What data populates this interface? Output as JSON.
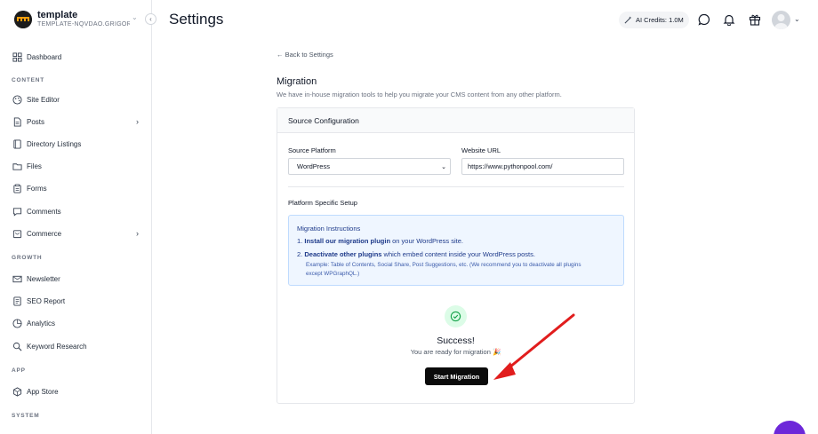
{
  "sidebar": {
    "brand": {
      "name": "template",
      "subtitle": "TEMPLATE-NQVDAO.GRIGOR..."
    },
    "items": [
      {
        "label": "Dashboard",
        "icon": "dashboard-icon"
      },
      {
        "label": "Site Editor",
        "icon": "palette-icon"
      },
      {
        "label": "Posts",
        "icon": "document-icon"
      },
      {
        "label": "Directory Listings",
        "icon": "book-icon"
      },
      {
        "label": "Files",
        "icon": "folder-icon"
      },
      {
        "label": "Forms",
        "icon": "clipboard-icon"
      },
      {
        "label": "Comments",
        "icon": "comment-icon"
      },
      {
        "label": "Commerce",
        "icon": "cart-icon"
      },
      {
        "label": "Newsletter",
        "icon": "mail-icon"
      },
      {
        "label": "SEO Report",
        "icon": "report-icon"
      },
      {
        "label": "Analytics",
        "icon": "analytics-icon"
      },
      {
        "label": "Keyword Research",
        "icon": "search-icon"
      },
      {
        "label": "App Store",
        "icon": "box-icon"
      }
    ],
    "sections": {
      "content": "CONTENT",
      "growth": "GROWTH",
      "app": "APP",
      "system": "SYSTEM"
    }
  },
  "header": {
    "title": "Settings",
    "credits": "AI Credits: 1.0M"
  },
  "main": {
    "back_link": "← Back to Settings",
    "title": "Migration",
    "description": "We have in-house migration tools to help you migrate your CMS content from any other platform.",
    "card_title": "Source Configuration",
    "source_platform_label": "Source Platform",
    "source_platform_value": "WordPress",
    "website_url_label": "Website URL",
    "website_url_value": "https://www.pythonpool.com/",
    "platform_setup_title": "Platform Specific Setup",
    "instructions": {
      "title": "Migration Instructions",
      "step1_num": "1.",
      "step1_bold": "Install our migration plugin",
      "step1_rest": " on your WordPress site.",
      "step2_num": "2.",
      "step2_bold": "Deactivate other plugins",
      "step2_rest": " which embed content inside your WordPress posts.",
      "note_line1": "Example: Table of Contents, Social Share, Post Suggestions, etc. (We recommend you to deactivate all plugins",
      "note_line2": "except WPGraphQL.)"
    },
    "success_title": "Success!",
    "success_desc": "You are ready for migration 🎉",
    "start_button": "Start Migration"
  },
  "colors": {
    "accent": "#6d28d9",
    "annotation": "#e11d1d",
    "success": "#16a34a"
  }
}
